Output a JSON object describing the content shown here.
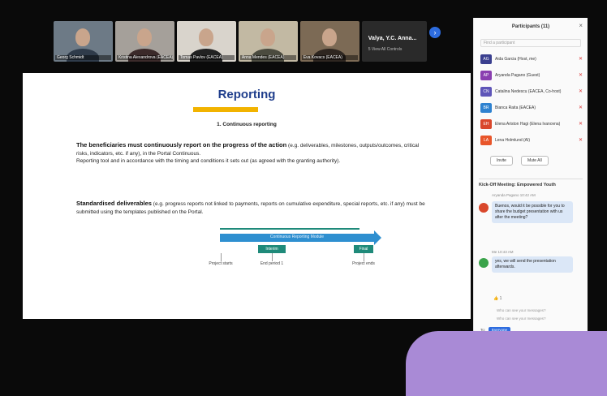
{
  "video": {
    "tiles": [
      {
        "name": "Georg Schmidt",
        "bg": "#6d7a86",
        "shirt": "#2f3b4a"
      },
      {
        "name": "Kristina Alexandrova (EACEA)",
        "bg": "#a5a09a",
        "shirt": "#3b2a2a"
      },
      {
        "name": "Tomas Pavlov (EACEA)",
        "bg": "#d9d4cc",
        "shirt": "#222"
      },
      {
        "name": "Anna Mendes (EACEA)",
        "bg": "#c2b9a3",
        "shirt": "#4b4b3f"
      },
      {
        "name": "Eva Kovacs (EACEA)",
        "bg": "#7c6a55",
        "shirt": "#2e2620"
      }
    ],
    "more_name": "Valya, Y.C. Anna...",
    "more_sub": "5 View All Controls",
    "more_arrow": "›"
  },
  "slide": {
    "title": "Reporting",
    "section": "1. Continuous reporting",
    "p1_bold": "The beneficiaries must continuously report on the progress of the action",
    "p1_rest": " (e.g. deliverables, milestones, outputs/outcomes, critical risks, indicators, etc. if any), in the Portal Continuous.",
    "p1_line2": "Reporting tool and in accordance with the timing and conditions it sets out (as agreed with the granting authority).",
    "p2_bold": "Standardised deliverables",
    "p2_rest": " (e.g. progress reports not linked to payments, reports on cumulative expenditure, special reports, etc. if any) must be submitted using the templates published on the Portal.",
    "bar_text": "Continuous Reporting Module",
    "tag1": "Interim",
    "tag2": "Final",
    "label1": "Project starts",
    "label2": "End period 1",
    "label3": "Project ends"
  },
  "panel": {
    "header": "Participants (11)",
    "close": "×",
    "search_placeholder": "Find a participant",
    "participants": [
      {
        "initials": "AG",
        "name": "Aida Garcia (Host, me)",
        "color": "#3a3f8f"
      },
      {
        "initials": "AP",
        "name": "Aryanda Pagano (Guest)",
        "color": "#8a3fb0"
      },
      {
        "initials": "CN",
        "name": "Catalina Nedescu (EACEA, Co-host)",
        "color": "#5e55b8"
      },
      {
        "initials": "BR",
        "name": "Bianca Raita (EACEA)",
        "color": "#2e82d0"
      },
      {
        "initials": "EH",
        "name": "Elena Ariston Hagi (Elena Ivanovna)",
        "color": "#d9472b"
      },
      {
        "initials": "LA",
        "name": "Lena Holmlund (AI)",
        "color": "#e8552a"
      }
    ],
    "invite_btn": "Invite",
    "mute_btn": "Mute All",
    "chat_header": "Kick-Off Meeting: Empowered Youth",
    "msg1_meta": "Aryanda Pagano  10:42 AM",
    "msg1": "Buenos, would it be possible for you to share the budget presentation with us after the meeting?",
    "msg2_meta": "Me  10:43 AM",
    "msg2": "yes, we will send the presentation afterwards.",
    "reaction": "👍 1",
    "foot1": "Who can see your messages?",
    "foot2": "Who can see your messages?",
    "to_label": "To:",
    "to_target": "Everyone"
  },
  "colors": {
    "accent": "#2d6cdf",
    "slide_title": "#1f3e8c",
    "title_bar": "#f2b300",
    "diagram": "#2e8fd0",
    "teal": "#1f8a7a"
  }
}
